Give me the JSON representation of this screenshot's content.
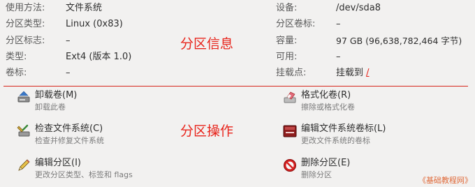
{
  "info_left": [
    {
      "label": "使用方法:",
      "value": "文件系统"
    },
    {
      "label": "分区类型:",
      "value": "Linux (0x83)"
    },
    {
      "label": "分区标志:",
      "value": "–"
    },
    {
      "label": "类型:",
      "value": "Ext4 (版本 1.0)"
    },
    {
      "label": "卷标:",
      "value": "–"
    }
  ],
  "info_right": [
    {
      "label": "设备:",
      "value": "/dev/sda8"
    },
    {
      "label": "分区卷标:",
      "value": "–"
    },
    {
      "label": "容量:",
      "value": "97 GB (96,638,782,464 字节)"
    },
    {
      "label": "可用:",
      "value": "–"
    },
    {
      "label": "挂载点:",
      "value": "挂载到",
      "link": "/"
    }
  ],
  "annotations": {
    "info": "分区信息",
    "ops": "分区操作"
  },
  "actions": [
    {
      "title": "卸载卷(M)",
      "desc": "卸载此卷",
      "icon": "eject-icon"
    },
    {
      "title": "格式化卷(R)",
      "desc": "擦除或格式化卷",
      "icon": "eraser-icon"
    },
    {
      "title": "检查文件系统(C)",
      "desc": "检查并修复文件系统",
      "icon": "wrench-check-icon"
    },
    {
      "title": "编辑文件系统卷标(L)",
      "desc": "更改文件系统的卷标",
      "icon": "label-edit-icon"
    },
    {
      "title": "编辑分区(I)",
      "desc": "更改分区类型、标签和 flags",
      "icon": "pencil-icon"
    },
    {
      "title": "删除分区(E)",
      "desc": "删除分区",
      "icon": "delete-icon"
    }
  ],
  "watermark": "《基础教程网》",
  "colors": {
    "accent": "#e8241b",
    "background": "#f2f1f0"
  }
}
